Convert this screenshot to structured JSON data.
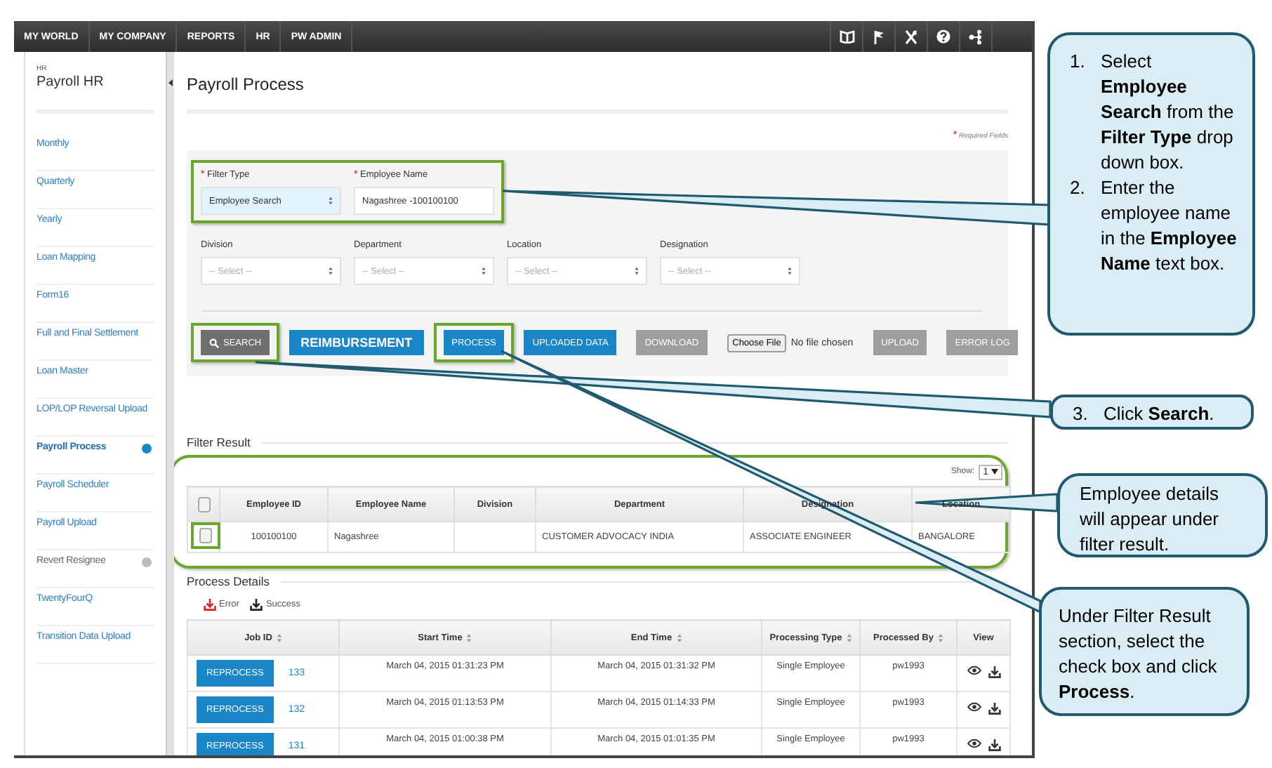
{
  "top_nav": {
    "items": [
      "MY WORLD",
      "MY COMPANY",
      "REPORTS",
      "HR",
      "PW ADMIN"
    ]
  },
  "sidebar": {
    "module_label": "HR",
    "module_name": "Payroll HR",
    "items": [
      {
        "label": "Monthly",
        "selected": false,
        "disabled": false
      },
      {
        "label": "Quarterly",
        "selected": false,
        "disabled": false
      },
      {
        "label": "Yearly",
        "selected": false,
        "disabled": false
      },
      {
        "label": "Loan Mapping",
        "selected": false,
        "disabled": false
      },
      {
        "label": "Form16",
        "selected": false,
        "disabled": false
      },
      {
        "label": "Full and Final Settlement",
        "selected": false,
        "disabled": false
      },
      {
        "label": "Loan Master",
        "selected": false,
        "disabled": false
      },
      {
        "label": "LOP/LOP Reversal Upload",
        "selected": false,
        "disabled": false
      },
      {
        "label": "Payroll Process",
        "selected": true,
        "disabled": false
      },
      {
        "label": "Payroll Scheduler",
        "selected": false,
        "disabled": false
      },
      {
        "label": "Payroll Upload",
        "selected": false,
        "disabled": false
      },
      {
        "label": "Revert Resignee",
        "selected": false,
        "disabled": true
      },
      {
        "label": "TwentyFourQ",
        "selected": false,
        "disabled": false
      },
      {
        "label": "Transition Data Upload",
        "selected": false,
        "disabled": false
      }
    ]
  },
  "page": {
    "title": "Payroll Process",
    "required_mark": "*",
    "required_note": "Required Fields"
  },
  "filter_rows": [
    {
      "highlighted": true,
      "fields": [
        {
          "label": "Filter Type",
          "required_mark": "*",
          "kind": "select",
          "value": "Employee Search",
          "focused": true
        },
        {
          "label": "Employee Name",
          "required_mark": "*",
          "kind": "text",
          "value": "Nagashree -100100100",
          "focused": false
        }
      ]
    },
    {
      "highlighted": false,
      "fields": [
        {
          "label": "Division",
          "kind": "select",
          "placeholder": "-- Select --",
          "focused": false
        },
        {
          "label": "Department",
          "kind": "select",
          "placeholder": "-- Select --",
          "focused": false
        },
        {
          "label": "Location",
          "kind": "select",
          "placeholder": "-- Select --",
          "focused": false
        },
        {
          "label": "Designation",
          "kind": "select",
          "placeholder": "-- Select --",
          "focused": false
        }
      ]
    }
  ],
  "actions": [
    {
      "kind": "search",
      "label": "SEARCH",
      "highlighted": true
    },
    {
      "kind": "large",
      "label": "REIMBURSEMENT",
      "highlighted": false
    },
    {
      "kind": "primary",
      "label": "PROCESS",
      "highlighted": true
    },
    {
      "kind": "primary",
      "label": "UPLOADED DATA",
      "highlighted": false
    },
    {
      "kind": "disabled",
      "label": "DOWNLOAD",
      "highlighted": false
    },
    {
      "kind": "file",
      "label": "Choose File",
      "status": "No file chosen",
      "highlighted": false
    },
    {
      "kind": "disabled",
      "label": "UPLOAD",
      "highlighted": false
    },
    {
      "kind": "disabled",
      "label": "ERROR LOG",
      "highlighted": false
    }
  ],
  "filter_result": {
    "title": "Filter Result",
    "highlighted": true,
    "show_label": "Show:",
    "page_size": "1",
    "select_all_checked": false,
    "columns": [
      "Employee ID",
      "Employee Name",
      "Division",
      "Department",
      "Designation",
      "Location"
    ],
    "rows": [
      {
        "checked": false,
        "highlighted": true,
        "cells": [
          "100100100",
          "Nagashree",
          null,
          "CUSTOMER ADVOCACY INDIA",
          "ASSOCIATE ENGINEER",
          "BANGALORE"
        ]
      }
    ]
  },
  "process_details": {
    "title": "Process Details",
    "legend": [
      {
        "kind": "error",
        "label": "Error"
      },
      {
        "kind": "success",
        "label": "Success"
      }
    ],
    "columns": [
      {
        "label": "Job ID",
        "sortable": true
      },
      {
        "label": "Start Time",
        "sortable": true
      },
      {
        "label": "End Time",
        "sortable": true
      },
      {
        "label": "Processing Type",
        "sortable": true
      },
      {
        "label": "Processed By",
        "sortable": true
      },
      {
        "label": "View",
        "sortable": false
      }
    ],
    "rows": [
      {
        "action": "REPROCESS",
        "job_id": "133",
        "start_time": "March 04, 2015 01:31:23 PM",
        "end_time": "March 04, 2015 01:31:32 PM",
        "processing_type": "Single Employee",
        "processed_by": "pw1993"
      },
      {
        "action": "REPROCESS",
        "job_id": "132",
        "start_time": "March 04, 2015 01:13:53 PM",
        "end_time": "March 04, 2015 01:14:33 PM",
        "processing_type": "Single Employee",
        "processed_by": "pw1993"
      },
      {
        "action": "REPROCESS",
        "job_id": "131",
        "start_time": "March 04, 2015 01:00:38 PM",
        "end_time": "March 04, 2015 01:01:35 PM",
        "processing_type": "Single Employee",
        "processed_by": "pw1993"
      }
    ]
  },
  "callouts": [
    {
      "kind": "steps",
      "items": [
        {
          "number": "1.",
          "text": "Select **Employee Search** from the **Filter Type** drop down box."
        },
        {
          "number": "2.",
          "text": "Enter the employee name in the **Employee Name** text box."
        }
      ]
    },
    {
      "kind": "steps",
      "items": [
        {
          "number": "3.",
          "text": "Click **Search**."
        }
      ]
    },
    {
      "kind": "note",
      "text": "Employee details will appear under filter result."
    },
    {
      "kind": "note",
      "text": "Under Filter Result section, select the check box and click **Process**."
    }
  ]
}
